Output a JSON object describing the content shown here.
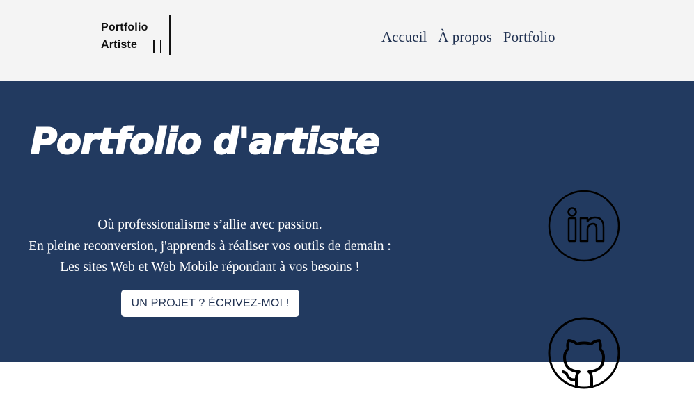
{
  "header": {
    "logo": {
      "line1": "Portfolio",
      "line2": "Artiste"
    },
    "nav": [
      {
        "label": "Accueil"
      },
      {
        "label": "À propos"
      },
      {
        "label": "Portfolio"
      }
    ]
  },
  "hero": {
    "title": "Portfolio d'artiste",
    "tagline": [
      "Où professionalisme s’allie avec passion.",
      "En pleine reconversion, j'apprends à réaliser vos outils de demain :",
      "Les sites Web et Web Mobile répondant à vos besoins !"
    ],
    "cta_label": "UN PROJET ? ÉCRIVEZ-MOI !"
  },
  "social": {
    "linkedin_icon": "linkedin-icon",
    "github_icon": "github-icon"
  },
  "colors": {
    "header_bg": "#f4f4f4",
    "hero_bg": "#223a60",
    "nav_text": "#1f3050",
    "hero_text": "#ffffff"
  }
}
